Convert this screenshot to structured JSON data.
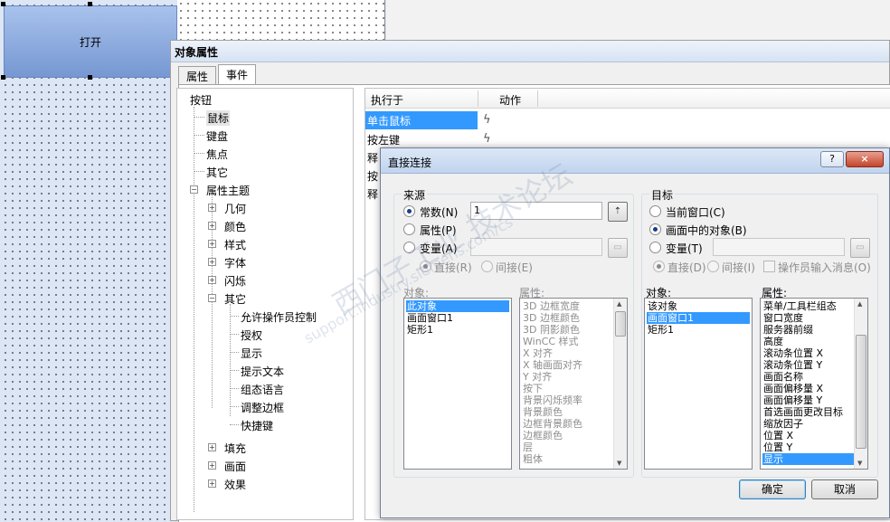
{
  "canvas": {
    "open_button_label": "打开"
  },
  "prop_panel": {
    "title": "对象属性",
    "tabs": [
      {
        "label": "属性"
      },
      {
        "label": "事件"
      }
    ],
    "tree": {
      "root": "按钮",
      "items": [
        "鼠标",
        "键盘",
        "焦点",
        "其它",
        "属性主题"
      ],
      "theme_children": [
        "几何",
        "颜色",
        "样式",
        "字体",
        "闪烁",
        "其它"
      ],
      "other_children": [
        "允许操作员控制",
        "授权",
        "显示",
        "提示文本",
        "组态语言",
        "调整边框",
        "快捷键"
      ],
      "tail_items": [
        "填充",
        "画面",
        "效果"
      ]
    },
    "events": {
      "header_trigger": "执行于",
      "header_action": "动作",
      "rows": [
        "单击鼠标",
        "按左键",
        "释",
        "按",
        "释"
      ]
    }
  },
  "dialog": {
    "title": "直接连接",
    "help": "?",
    "close": "×",
    "source": {
      "legend": "来源",
      "options": [
        "常数(N)",
        "属性(P)",
        "变量(A)"
      ],
      "selected": "常数(N)",
      "constant_value": "1",
      "direct": "直接(R)",
      "indirect": "间接(E)",
      "object_label": "对象:",
      "objects": [
        "此对象",
        "画面窗口1",
        "矩形1"
      ],
      "selected_object": "此对象",
      "property_label": "属性:",
      "properties": [
        "3D 边框宽度",
        "3D 边框颜色",
        "3D 阴影颜色",
        "WinCC 样式",
        "X 对齐",
        "X 轴画面对齐",
        "Y 对齐",
        "按下",
        "背景闪烁频率",
        "背景颜色",
        "边框背景颜色",
        "边框颜色",
        "层",
        "粗体"
      ]
    },
    "target": {
      "legend": "目标",
      "options": [
        "当前窗口(C)",
        "画面中的对象(B)",
        "变量(T)"
      ],
      "selected": "画面中的对象(B)",
      "direct": "直接(D)",
      "indirect": "间接(I)",
      "operator_input": "操作员输入消息(O)",
      "object_label": "对象:",
      "objects": [
        "该对象",
        "画面窗口1",
        "矩形1"
      ],
      "selected_object": "画面窗口1",
      "property_label": "属性:",
      "properties": [
        "菜单/工具栏组态",
        "窗口宽度",
        "服务器前缀",
        "高度",
        "滚动条位置 X",
        "滚动条位置 Y",
        "画面名称",
        "画面偏移量 X",
        "画面偏移量 Y",
        "首选画面更改目标",
        "缩放因子",
        "位置 X",
        "位置 Y",
        "显示"
      ],
      "selected_property": "显示"
    },
    "ok_label": "确定",
    "cancel_label": "取消"
  },
  "watermark": {
    "text": "西门子工业 技术论坛",
    "url": "support.industry.siemens.com/cs"
  }
}
